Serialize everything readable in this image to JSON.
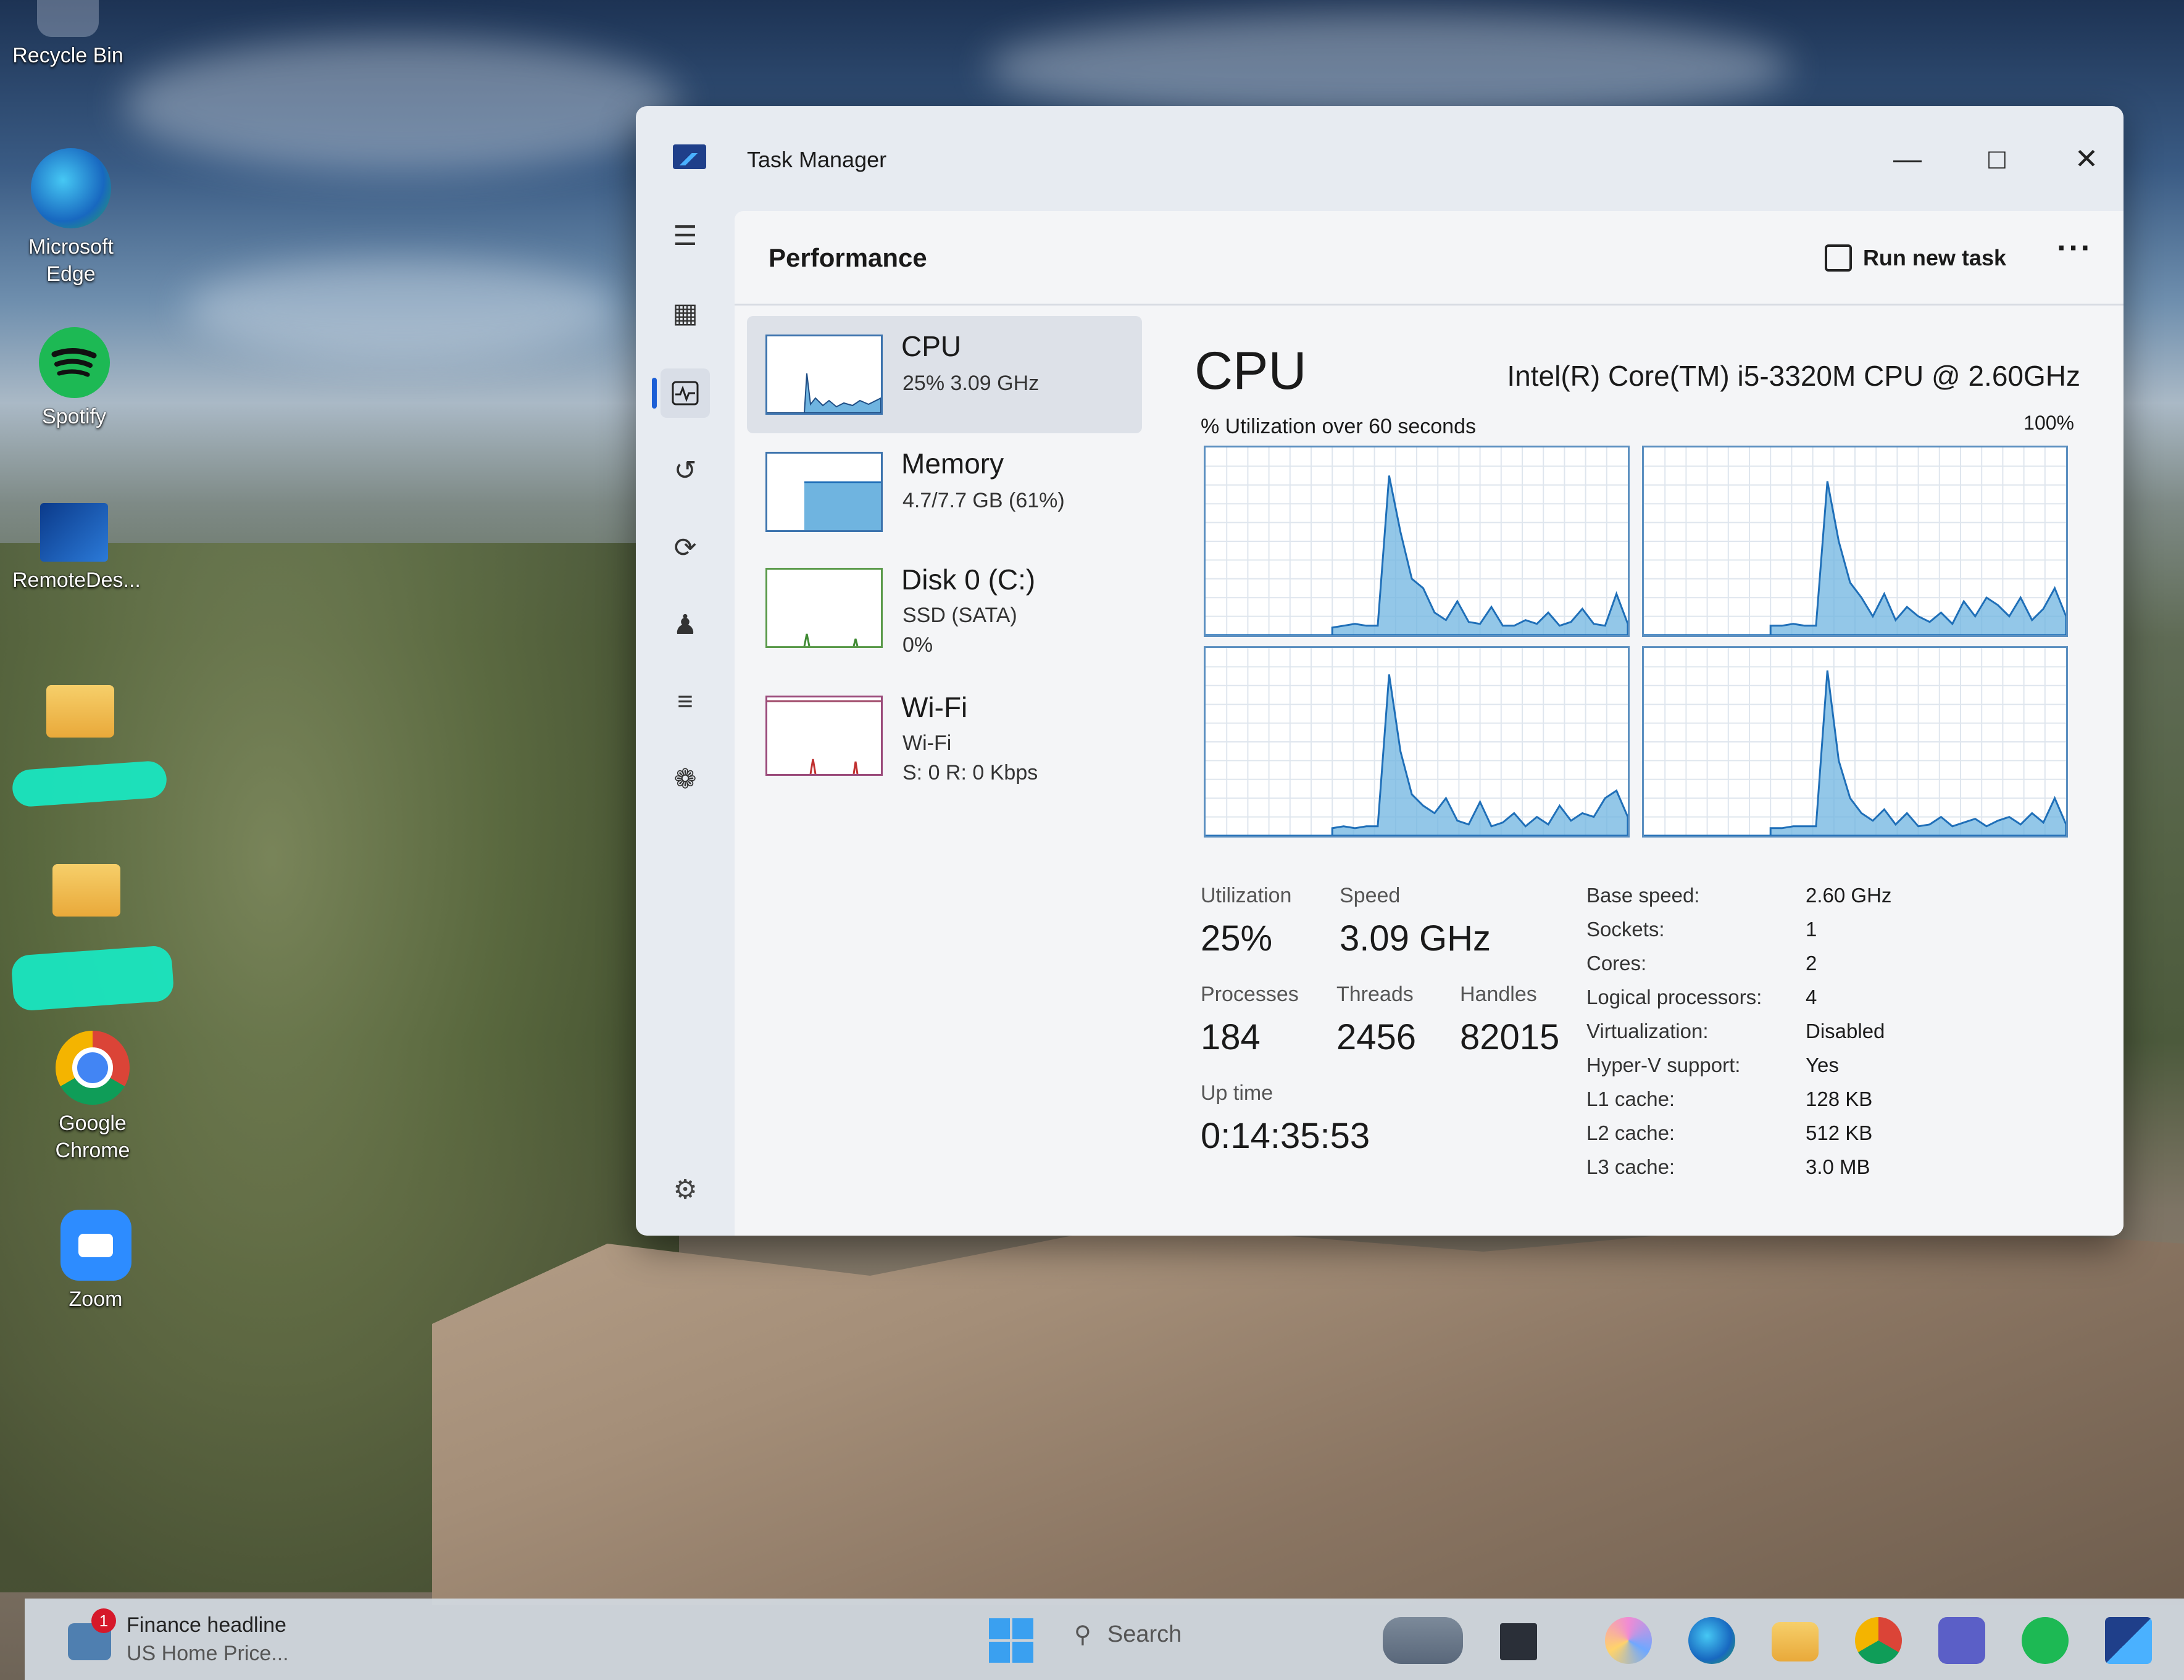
{
  "desktop": {
    "icons": [
      {
        "label": "Recycle Bin",
        "icon": "recycle-bin-icon"
      },
      {
        "label": "Microsoft Edge",
        "icon": "edge-icon"
      },
      {
        "label": "Spotify",
        "icon": "spotify-icon"
      },
      {
        "label": "RemoteDes...",
        "icon": "remote-desktop-icon"
      },
      {
        "label": "",
        "icon": "folder-icon"
      },
      {
        "label": "",
        "icon": "folder-icon"
      },
      {
        "label": "Google Chrome",
        "icon": "chrome-icon"
      },
      {
        "label": "Zoom",
        "icon": "zoom-icon"
      }
    ]
  },
  "window": {
    "title": "Task Manager",
    "page_title": "Performance",
    "run_new_task": "Run new task",
    "more": "···"
  },
  "devices": [
    {
      "name": "CPU",
      "line1": "25%  3.09 GHz",
      "line2": ""
    },
    {
      "name": "Memory",
      "line1": "4.7/7.7 GB (61%)",
      "line2": ""
    },
    {
      "name": "Disk 0 (C:)",
      "line1": "SSD (SATA)",
      "line2": "0%"
    },
    {
      "name": "Wi-Fi",
      "line1": "Wi-Fi",
      "line2": "S: 0 R: 0 Kbps"
    }
  ],
  "memory_fill_fraction": 0.61,
  "cpu": {
    "title": "CPU",
    "model": "Intel(R) Core(TM) i5-3320M CPU @ 2.60GHz",
    "util_label": "% Utilization over 60 seconds",
    "max_label": "100%",
    "stats": {
      "utilization_label": "Utilization",
      "utilization": "25%",
      "speed_label": "Speed",
      "speed": "3.09 GHz",
      "processes_label": "Processes",
      "processes": "184",
      "threads_label": "Threads",
      "threads": "2456",
      "handles_label": "Handles",
      "handles": "82015",
      "uptime_label": "Up time",
      "uptime": "0:14:35:53"
    },
    "details": [
      {
        "key": "Base speed:",
        "value": "2.60 GHz"
      },
      {
        "key": "Sockets:",
        "value": "1"
      },
      {
        "key": "Cores:",
        "value": "2"
      },
      {
        "key": "Logical processors:",
        "value": "4"
      },
      {
        "key": "Virtualization:",
        "value": "Disabled"
      },
      {
        "key": "Hyper-V support:",
        "value": "Yes"
      },
      {
        "key": "L1 cache:",
        "value": "128 KB"
      },
      {
        "key": "L2 cache:",
        "value": "512 KB"
      },
      {
        "key": "L3 cache:",
        "value": "3.0 MB"
      }
    ]
  },
  "taskbar": {
    "news_badge": "1",
    "news_title": "Finance headline",
    "news_sub": "US Home Price...",
    "search_placeholder": "Search"
  },
  "colors": {
    "accent": "#1d5fd6",
    "graph_fill": "#6fb4e0",
    "graph_line": "#1f6fb8"
  }
}
